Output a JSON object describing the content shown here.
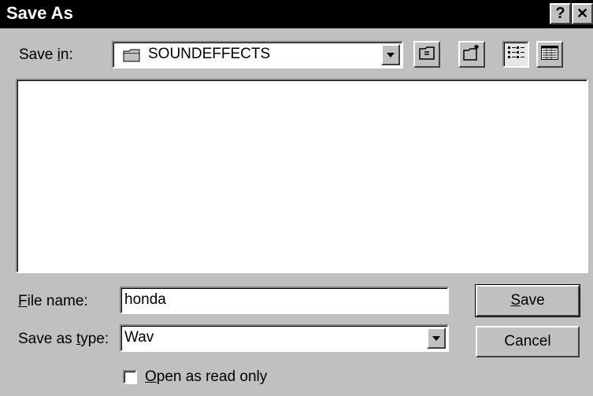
{
  "dialog": {
    "title": "Save As"
  },
  "titlebar": {
    "help_label": "?",
    "close_label": "✕"
  },
  "save_in": {
    "label_before": "Save ",
    "label_mnemonic": "i",
    "label_after": "n:",
    "value": "SOUNDEFFECTS",
    "icons": [
      "folder-icon",
      "up-one-level-icon",
      "create-new-folder-icon",
      "list-view-icon",
      "details-view-icon"
    ]
  },
  "file_name": {
    "label_mnemonic": "F",
    "label_after": "ile name:",
    "value": "honda"
  },
  "save_as_type": {
    "label_before": "Save as ",
    "label_mnemonic": "t",
    "label_after": "ype:",
    "value": "Wav"
  },
  "read_only": {
    "label_mnemonic": "O",
    "label_after": "pen as read only",
    "checked": false
  },
  "buttons": {
    "save_mnemonic": "S",
    "save_after": "ave",
    "cancel": "Cancel"
  }
}
